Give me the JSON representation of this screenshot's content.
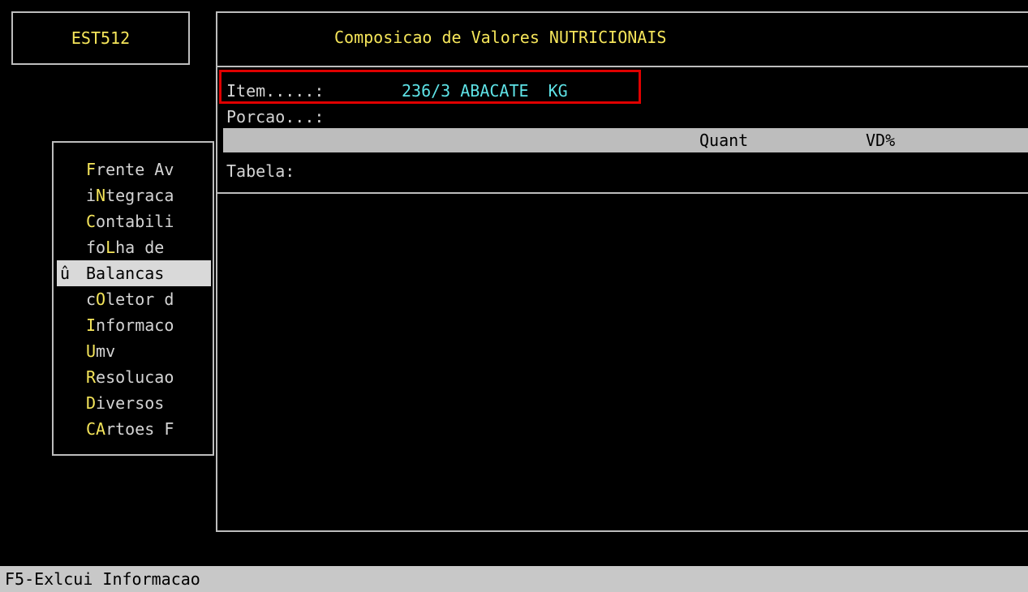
{
  "left_box": {
    "code": "EST512"
  },
  "main": {
    "title": "Composicao de Valores NUTRICIONAIS",
    "item_label": "Item.....:",
    "item_value": "236/3 ABACATE  KG",
    "porcao_label": "Porcao...:",
    "columns": {
      "quant": "Quant",
      "vd": "VD%"
    },
    "tabela_label": "Tabela:"
  },
  "menu": {
    "items": [
      {
        "hot": "F",
        "rest": "rente Av",
        "pre": "",
        "selected": false
      },
      {
        "pre": "i",
        "hot": "N",
        "rest": "tegraca",
        "selected": false
      },
      {
        "pre": "",
        "hot": "C",
        "rest": "ontabili",
        "selected": false
      },
      {
        "pre": "fo",
        "hot": "L",
        "rest": "ha de",
        "selected": false
      },
      {
        "pre": "",
        "hot": "",
        "rest": "Balancas",
        "selected": true,
        "marker": "û"
      },
      {
        "pre": "c",
        "hot": "O",
        "rest": "letor d",
        "selected": false
      },
      {
        "pre": "",
        "hot": "I",
        "rest": "nformaco",
        "selected": false
      },
      {
        "pre": "",
        "hot": "U",
        "rest": "mv",
        "selected": false
      },
      {
        "pre": "",
        "hot": "R",
        "rest": "esolucao",
        "selected": false
      },
      {
        "pre": "",
        "hot": "D",
        "rest": "iversos",
        "selected": false
      },
      {
        "pre": "",
        "hot": "CA",
        "rest": "rtoes F",
        "selected": false
      }
    ]
  },
  "status_bar": {
    "text": "F5-Exlcui Informacao"
  },
  "colors": {
    "background": "#000000",
    "text": "#d4d4d4",
    "title": "#f5e55a",
    "value": "#5ee3e7",
    "highlight": "#e00000",
    "bar": "#bdbdbd"
  }
}
